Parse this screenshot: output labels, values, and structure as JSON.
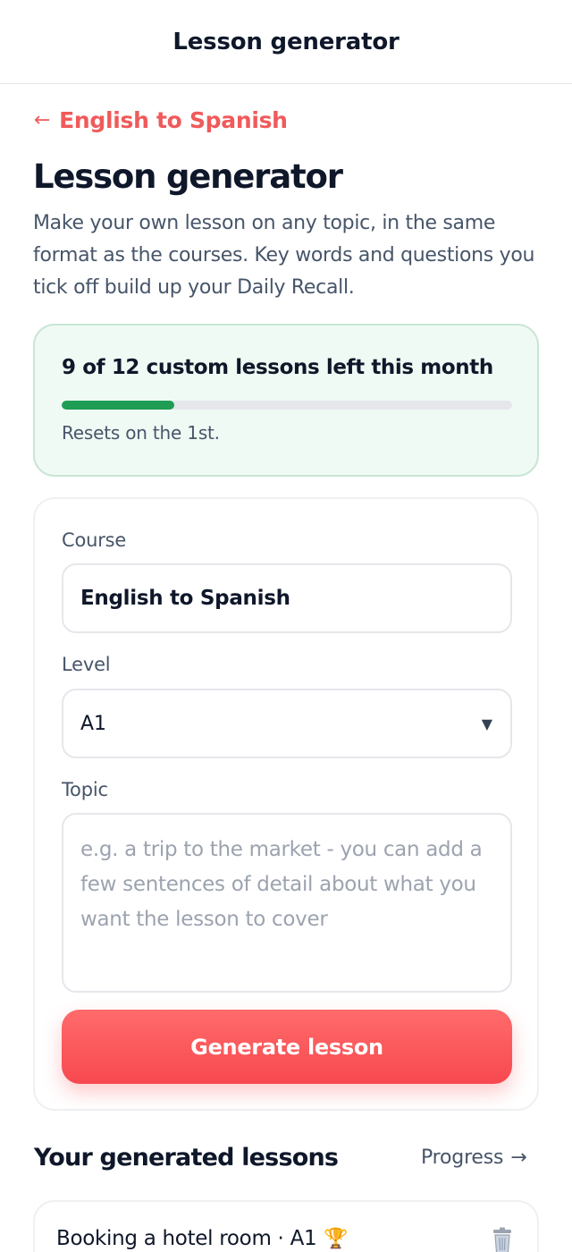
{
  "header": {
    "title": "Lesson generator"
  },
  "back": {
    "arrow": "←",
    "label": "English to Spanish"
  },
  "page": {
    "title": "Lesson generator",
    "description": "Make your own lesson on any topic, in the same format as the courses. Key words and questions you tick off build up your Daily Recall."
  },
  "quota": {
    "text": "9 of 12 custom lessons left this month",
    "used": 3,
    "total": 12,
    "reset": "Resets on the 1st.",
    "color": "#1f9d55"
  },
  "form": {
    "course_label": "Course",
    "course_value": "English to Spanish",
    "level_label": "Level",
    "level_value": "A1",
    "topic_label": "Topic",
    "topic_placeholder": "e.g. a trip to the market - you can add a few sentences of detail about what you want the lesson to cover",
    "generate_label": "Generate lesson"
  },
  "lessons": {
    "title": "Your generated lessons",
    "progress_label": "Progress",
    "progress_arrow": "→",
    "items": [
      {
        "title": "Booking a hotel room · A1",
        "badge_icon": "trophy-icon"
      }
    ]
  },
  "colors": {
    "accent": "#f05a5a",
    "button": "#f7494f",
    "quota_bg": "#f0faf4"
  }
}
